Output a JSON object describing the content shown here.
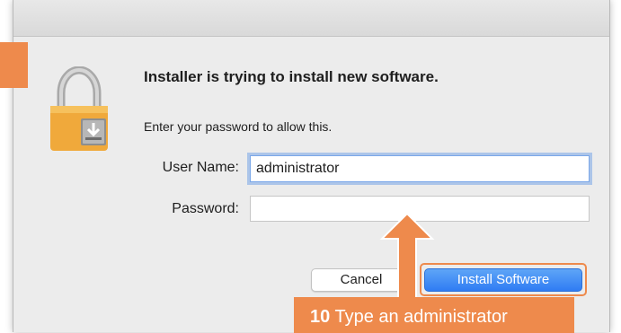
{
  "dialog": {
    "heading": "Installer is trying to install new software.",
    "subtext": "Enter your password to allow this.",
    "username_label": "User Name:",
    "username_value": "administrator",
    "password_label": "Password:",
    "password_value": "",
    "cancel_label": "Cancel",
    "install_label": "Install Software"
  },
  "callout": {
    "step": "10",
    "text": "Type an administrator"
  },
  "icons": {
    "lock": "lock-icon",
    "arrow": "arrow-up-icon"
  },
  "colors": {
    "accent_orange": "#ee8a4c",
    "primary_blue": "#2f7cf3",
    "dialog_bg": "#ececec"
  }
}
